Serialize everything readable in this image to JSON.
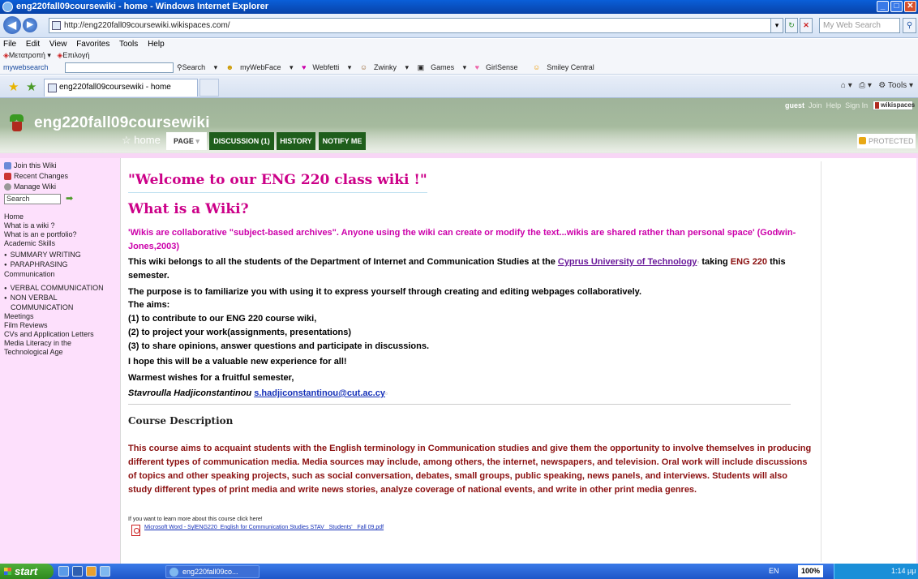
{
  "window": {
    "title": "eng220fall09coursewiki - home - Windows Internet Explorer"
  },
  "browser": {
    "address": "http://eng220fall09coursewiki.wikispaces.com/",
    "search_placeholder": "My Web Search",
    "menu": [
      "File",
      "Edit",
      "View",
      "Favorites",
      "Tools",
      "Help"
    ],
    "toolbar2": {
      "item1": "Μετατροπή",
      "item2": "Επιλογή"
    },
    "toolbar3": {
      "mywebsearch": "mywebsearch",
      "search": "Search",
      "links": [
        "myWebFace",
        "Webfetti",
        "Zwinky",
        "Games",
        "GirlSense",
        "Smiley Central"
      ]
    },
    "tab_title": "eng220fall09coursewiki - home",
    "tools_label": "Tools"
  },
  "wiki": {
    "name": "eng220fall09coursewiki",
    "user_links": [
      "guest",
      "Join",
      "Help",
      "Sign In"
    ],
    "badge": "wikispaces",
    "tabs": {
      "home": "home",
      "page": "PAGE",
      "discussion": "DISCUSSION (1)",
      "history": "HISTORY",
      "notify": "NOTIFY ME"
    },
    "protected": "PROTECTED"
  },
  "sidebar": {
    "join": "Join this Wiki",
    "recent": "Recent Changes",
    "manage": "Manage Wiki",
    "search": "Search",
    "links": [
      "Home",
      "What is a wiki ?",
      "What is an e portfolio?",
      "Academic Skills"
    ],
    "list1": [
      "SUMMARY WRITING",
      "PARAPHRASING"
    ],
    "communication": "Communication",
    "list2": [
      "VERBAL COMMUNICATION",
      "NON VERBAL COMMUNICATION"
    ],
    "links2": [
      "Meetings",
      "Film Reviews",
      "CVs and Application Letters",
      "Media Literacy in the Technological Age"
    ]
  },
  "content": {
    "welcome": "\"Welcome to our ENG 220 class wiki !\"",
    "what_is_wiki": "What is a Wiki?",
    "quote": "'Wikis are collaborative \"subject-based archives\". Anyone using the wiki can create or modify the text...wikis are shared rather than personal space' (Godwin-Jones,2003)",
    "belongs_1": "This wiki belongs to all the students of the Department of Internet and Communication Studies at the ",
    "belongs_link": "Cyprus University of Technology",
    "belongs_2": " taking ",
    "belongs_eng": "ENG 220",
    "belongs_3": " this semester.",
    "purpose": "The purpose is to familiarize you with using it to express yourself through creating and editing webpages collaboratively.",
    "aims": "The aims:",
    "aim1": "(1) to contribute to our ENG 220 course wiki,",
    "aim2": "(2) to project your work(assignments, presentations)",
    "aim3": "(3) to share opinions, answer questions and participate in discussions.",
    "hope": "I hope this will be a valuable new experience for all!",
    "wishes": "Warmest wishes for a fruitful semester,",
    "author": "Stavroulla Hadjiconstantinou ",
    "email": "s.hadjiconstantinou@cut.ac.cy",
    "course_heading": "Course Description",
    "course_text": "This course aims to acquaint students with the English terminology in Communication studies and give them the opportunity to involve themselves in producing different types of communication media. Media sources may include, among others, the internet, newspapers, and television. Oral work will include discussions of topics and other speaking projects, such as social conversation, debates, small groups, public speaking, news panels, and interviews. Students will also study different types of print media and write news stories, analyze coverage of national events, and write in other print media genres.",
    "learn_more": "If you want to learn more about this course click here!",
    "pdf_link": "Microsoft Word - SylENG220_English for Communication Studies STAV _Students'_ Fall 09.pdf"
  },
  "taskbar": {
    "start": "start",
    "task": "eng220fall09co...",
    "lang": "EN",
    "zoom": "100%",
    "time": "1:14 μμ"
  }
}
